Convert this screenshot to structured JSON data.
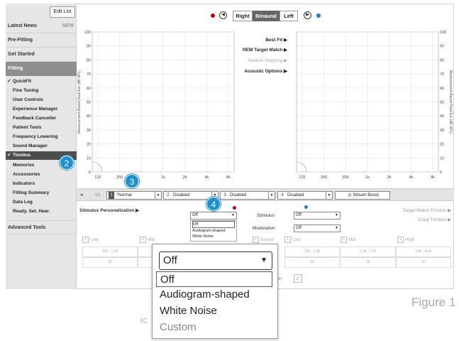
{
  "sidebar": {
    "edit_list": "Edit List",
    "sections": [
      {
        "label": "Latest News",
        "badge": "NEW"
      },
      {
        "label": "Pre-Fitting"
      },
      {
        "label": "Get Started"
      }
    ],
    "fitting": "Fitting",
    "items": [
      {
        "label": "QuickFit",
        "checked": true
      },
      {
        "label": "Fine Tuning"
      },
      {
        "label": "User Controls"
      },
      {
        "label": "Experience Manager"
      },
      {
        "label": "Feedback Canceller"
      },
      {
        "label": "Patient Tools"
      },
      {
        "label": "Frequency Lowering"
      },
      {
        "label": "Sound Manager"
      },
      {
        "label": "Tinnitus",
        "checked": true,
        "active": true
      },
      {
        "label": "Memories"
      },
      {
        "label": "Accessories"
      },
      {
        "label": "Indicators"
      },
      {
        "label": "Fitting Summary"
      },
      {
        "label": "Data Log"
      },
      {
        "label": "Ready. Set. Hear."
      }
    ],
    "advanced": "Advanced Tools"
  },
  "topbar": {
    "ears": [
      "Right",
      "Binaural",
      "Left"
    ],
    "selected": "Binaural"
  },
  "chart_menu": {
    "best_fit": "Best Fit",
    "rem": "REM Target Match",
    "speech": "Speech Mapping",
    "acoustic": "Acoustic Options",
    "arrow": "▶"
  },
  "chart_data": [
    {
      "type": "line",
      "ylabel": "Measurement-Based Real Ear (dB SPL)",
      "ylim": [
        0,
        100
      ],
      "y_ticks": [
        "100",
        "90",
        "80",
        "70",
        "60",
        "50",
        "40",
        "30",
        "20",
        "10",
        "0"
      ],
      "x_ticks": [
        "125",
        "250",
        "500",
        "1k",
        "2k",
        "4k",
        "8k"
      ],
      "x_ticks_visible": [
        "125",
        "250",
        "",
        "1k",
        "2k",
        "4k",
        "8k"
      ],
      "series": []
    },
    {
      "type": "line",
      "ylabel": "Measurement-Based Real Ear (dB SPL)",
      "ylim": [
        0,
        100
      ],
      "y_ticks": [
        "100",
        "90",
        "80",
        "70",
        "60",
        "50",
        "40",
        "30",
        "20",
        "10",
        "0"
      ],
      "x_ticks": [
        "125",
        "250",
        "500",
        "1k",
        "2k",
        "4k",
        "8k"
      ],
      "series": []
    }
  ],
  "programs": [
    {
      "num": "1",
      "label": "*Normal"
    },
    {
      "num": "2",
      "label": "Disabled"
    },
    {
      "num": "3",
      "label": "Disabled"
    },
    {
      "num": "4",
      "label": "Disabled"
    }
  ],
  "stream_boost": "Stream Boost",
  "stimulus_personalization": "Stimulus Personalization",
  "left_select": {
    "value": "Off",
    "options": [
      "Off",
      "Audiogram-shaped",
      "White Noise"
    ]
  },
  "stimulus_label": "Stimulus",
  "stimulus_value": "Off",
  "modulation_label": "Modulation",
  "modulation_value": "Off",
  "target_match": "Target Match Tinnitus",
  "copy_tinnitus": "Copy Tinnitus",
  "bands_left": [
    "Low",
    "Mid"
  ],
  "bands_right": [
    "Sound",
    "Low",
    "Mid",
    "High"
  ],
  "ranges": [
    "150 - 1.3k",
    "150 - 1.3k",
    "1.3k - 3.1k",
    "3.6k - 8.4k"
  ],
  "levels": [
    "30",
    "30",
    "30",
    "30"
  ],
  "on_label": "On",
  "zoom": {
    "value": "Off",
    "options": [
      "Off",
      "Audiogram-shaped",
      "White Noise",
      "Custom"
    ],
    "cut_text": "ic"
  },
  "callouts": [
    "2",
    "3",
    "4"
  ],
  "figure": "Figure 1"
}
